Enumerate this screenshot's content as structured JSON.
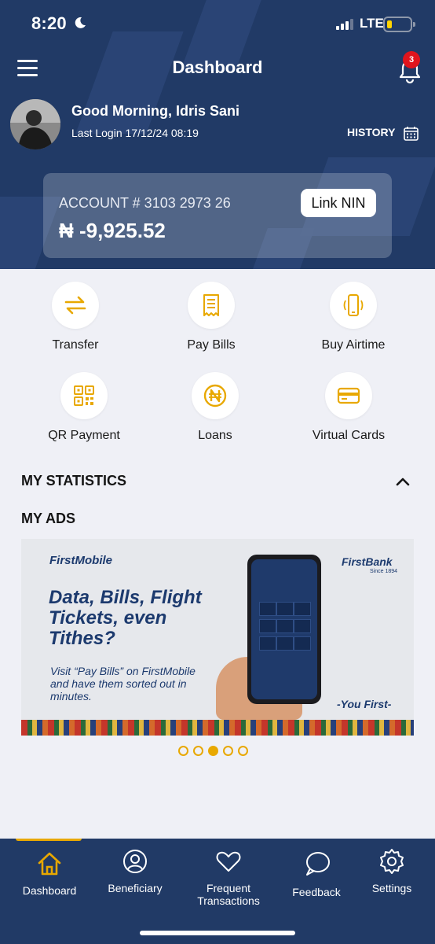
{
  "status_bar": {
    "time": "8:20",
    "network": "LTE",
    "battery_level": 0.15
  },
  "header": {
    "title": "Dashboard",
    "notification_count": "3"
  },
  "user": {
    "greeting": "Good Morning, Idris Sani",
    "last_login": "Last Login 17/12/24 08:19",
    "history_label": "HISTORY"
  },
  "account": {
    "number": "ACCOUNT # 3103 2973 26",
    "balance": "₦ -9,925.52",
    "link_nin_label": "Link NIN"
  },
  "actions": [
    {
      "label": "Transfer",
      "icon": "transfer-icon"
    },
    {
      "label": "Pay Bills",
      "icon": "receipt-icon"
    },
    {
      "label": "Buy Airtime",
      "icon": "phone-vibrate-icon"
    },
    {
      "label": "QR Payment",
      "icon": "qr-code-icon"
    },
    {
      "label": "Loans",
      "icon": "naira-coin-icon"
    },
    {
      "label": "Virtual Cards",
      "icon": "card-icon"
    }
  ],
  "sections": {
    "statistics": "MY STATISTICS",
    "ads": "MY ADS"
  },
  "ad": {
    "brand_left": "FirstMobile",
    "headline": "Data, Bills, Flight Tickets, even Tithes?",
    "subtext": "Visit “Pay Bills” on FirstMobile and have them sorted out in minutes.",
    "brand_right": "FirstBank",
    "brand_since": "Since 1894",
    "tagline": "-You First-",
    "carousel_total": 5,
    "carousel_active": 3
  },
  "tabs": [
    {
      "label": "Dashboard",
      "icon": "home-icon",
      "active": true
    },
    {
      "label": "Beneficiary",
      "icon": "user-icon",
      "active": false
    },
    {
      "label": "Frequent Transactions",
      "icon": "heart-icon",
      "active": false
    },
    {
      "label": "Feedback",
      "icon": "chat-icon",
      "active": false
    },
    {
      "label": "Settings",
      "icon": "gear-icon",
      "active": false
    }
  ],
  "colors": {
    "navy": "#213a66",
    "accent": "#e8a800",
    "background": "#eff0f6"
  }
}
